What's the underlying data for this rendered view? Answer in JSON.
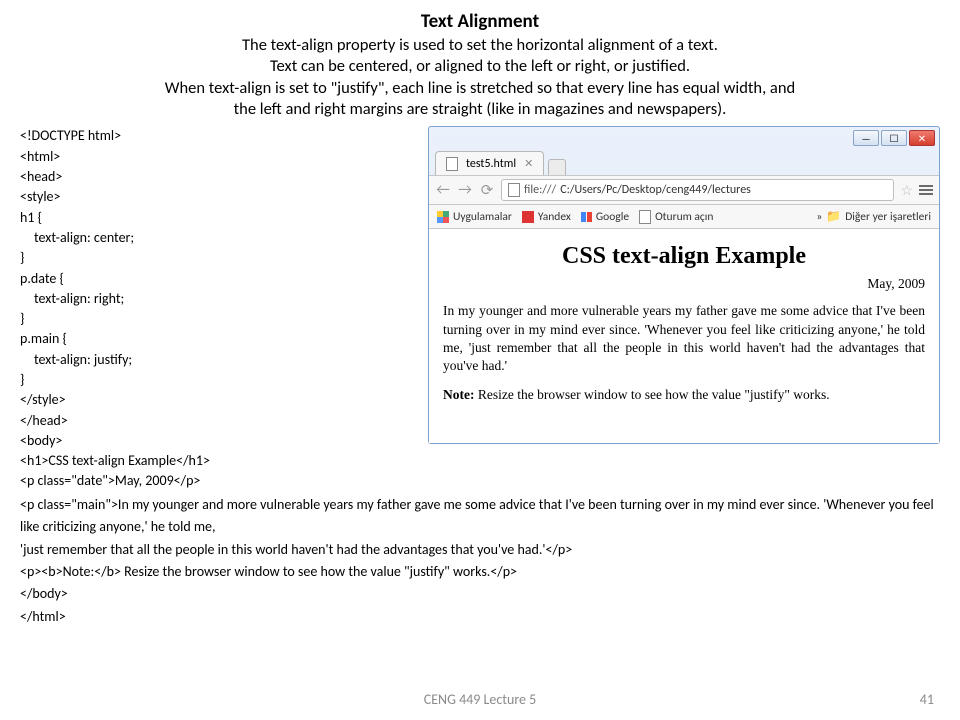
{
  "title": {
    "heading": "Text Alignment",
    "line1": "The text-align property is used to set the horizontal alignment of a text.",
    "line2": "Text can be centered, or aligned to the left or right, or justified.",
    "line3": "When text-align is set to \"justify\", each line is stretched so that every line has equal width, and",
    "line4": "the left and right margins are straight (like in magazines and newspapers)."
  },
  "code": {
    "l1": "<!DOCTYPE html>",
    "l2": "<html>",
    "l3": "<head>",
    "l4": "<style>",
    "l5": "h1 {",
    "l6": "text-align: center;",
    "l7": "}",
    "l8": "p.date {",
    "l9": "text-align: right;",
    "l10": "}",
    "l11": "p.main {",
    "l12": "text-align: justify;",
    "l13": "}",
    "l14": "</style>",
    "l15": "</head>",
    "l16": "<body>",
    "l17": "<h1>CSS text-align Example</h1>",
    "l18": "<p class=\"date\">May, 2009</p>",
    "l19": "<p class=\"main\">In my younger and more vulnerable years my father gave me some advice that I've been turning over in my mind ever since. 'Whenever you feel like criticizing anyone,' he told me,",
    "l20": "'just remember that all the people in this world haven't had the advantages that you've had.'</p>",
    "l21": "<p><b>Note:</b> Resize the browser window to see how the value \"justify\" works.</p>",
    "l22": "</body>",
    "l23": "</html>"
  },
  "browser": {
    "win_min": "—",
    "win_max": "☐",
    "win_close": "✕",
    "tab_title": "test5.html",
    "tab_close": "✕",
    "url_prefix": "file:///",
    "url_path": "C:/Users/Pc/Desktop/ceng449/lectures",
    "bookmarks": {
      "apps": "Uygulamalar",
      "yandex": "Yandex",
      "google": "Google",
      "login": "Oturum açın",
      "other": "Diğer yer işaretleri"
    },
    "page": {
      "h1": "CSS text-align Example",
      "date": "May, 2009",
      "para": "In my younger and more vulnerable years my father gave me some advice that I've been turning over in my mind ever since. 'Whenever you feel like criticizing anyone,' he told me, 'just remember that all the people in this world haven't had the advantages that you've had.'",
      "note_label": "Note:",
      "note_text": " Resize the browser window to see how the value \"justify\" works."
    }
  },
  "footer": {
    "center": "CENG 449 Lecture 5",
    "page": "41"
  }
}
